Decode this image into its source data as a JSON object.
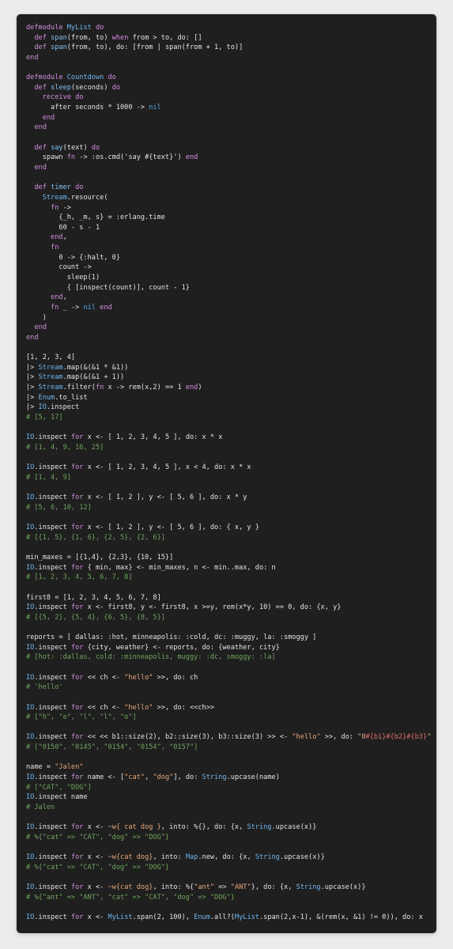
{
  "colors": {
    "background": "#1f1f1f",
    "text": "#e4e4e4",
    "keyword": "#d48ee0",
    "module": "#6fb6f0",
    "function": "#7ec2f5",
    "string": "#e8a87c",
    "comment": "#6fa55d",
    "atom": "#4fa6e8",
    "interpolation": "#e06c75"
  },
  "lines": [
    [
      [
        "keyword",
        "defmodule "
      ],
      [
        "module",
        "MyList"
      ],
      [
        "keyword",
        " do"
      ]
    ],
    [
      [
        "text",
        "  "
      ],
      [
        "keyword",
        "def "
      ],
      [
        "func",
        "span"
      ],
      [
        "text",
        "(from, to) "
      ],
      [
        "keyword",
        "when"
      ],
      [
        "text",
        " from > to, do: []"
      ]
    ],
    [
      [
        "text",
        "  "
      ],
      [
        "keyword",
        "def "
      ],
      [
        "func",
        "span"
      ],
      [
        "text",
        "(from, to), do: [from | span(from + 1, to)]"
      ]
    ],
    [
      [
        "keyword",
        "end"
      ]
    ],
    [],
    [
      [
        "keyword",
        "defmodule "
      ],
      [
        "module",
        "Countdown"
      ],
      [
        "keyword",
        " do"
      ]
    ],
    [
      [
        "text",
        "  "
      ],
      [
        "keyword",
        "def "
      ],
      [
        "func",
        "sleep"
      ],
      [
        "text",
        "(seconds) "
      ],
      [
        "keyword",
        "do"
      ]
    ],
    [
      [
        "text",
        "    "
      ],
      [
        "keyword",
        "receive do"
      ]
    ],
    [
      [
        "text",
        "      after seconds * 1000 -> "
      ],
      [
        "atom",
        "nil"
      ]
    ],
    [
      [
        "text",
        "    "
      ],
      [
        "keyword",
        "end"
      ]
    ],
    [
      [
        "text",
        "  "
      ],
      [
        "keyword",
        "end"
      ]
    ],
    [],
    [
      [
        "text",
        "  "
      ],
      [
        "keyword",
        "def "
      ],
      [
        "func",
        "say"
      ],
      [
        "text",
        "(text) "
      ],
      [
        "keyword",
        "do"
      ]
    ],
    [
      [
        "text",
        "    spawn "
      ],
      [
        "keyword",
        "fn"
      ],
      [
        "text",
        " -> :os.cmd('say #{text}') "
      ],
      [
        "keyword",
        "end"
      ]
    ],
    [
      [
        "text",
        "  "
      ],
      [
        "keyword",
        "end"
      ]
    ],
    [],
    [
      [
        "text",
        "  "
      ],
      [
        "keyword",
        "def "
      ],
      [
        "func",
        "timer "
      ],
      [
        "keyword",
        "do"
      ]
    ],
    [
      [
        "text",
        "    "
      ],
      [
        "module",
        "Stream"
      ],
      [
        "text",
        ".resource("
      ]
    ],
    [
      [
        "text",
        "      "
      ],
      [
        "keyword",
        "fn"
      ],
      [
        "text",
        " ->"
      ]
    ],
    [
      [
        "text",
        "        {_h, _m, s} = :erlang.time"
      ]
    ],
    [
      [
        "text",
        "        60 - s - 1"
      ]
    ],
    [
      [
        "text",
        "      "
      ],
      [
        "keyword",
        "end"
      ],
      [
        "text",
        ","
      ]
    ],
    [
      [
        "text",
        "      "
      ],
      [
        "keyword",
        "fn"
      ]
    ],
    [
      [
        "text",
        "        0 -> {:halt, 0}"
      ]
    ],
    [
      [
        "text",
        "        count ->"
      ]
    ],
    [
      [
        "text",
        "          sleep(1)"
      ]
    ],
    [
      [
        "text",
        "          { [inspect(count)], count - 1}"
      ]
    ],
    [
      [
        "text",
        "      "
      ],
      [
        "keyword",
        "end"
      ],
      [
        "text",
        ","
      ]
    ],
    [
      [
        "text",
        "      "
      ],
      [
        "keyword",
        "fn"
      ],
      [
        "text",
        " _ -> "
      ],
      [
        "atom",
        "nil"
      ],
      [
        "keyword",
        " end"
      ]
    ],
    [
      [
        "text",
        "    )"
      ]
    ],
    [
      [
        "text",
        "  "
      ],
      [
        "keyword",
        "end"
      ]
    ],
    [
      [
        "keyword",
        "end"
      ]
    ],
    [],
    [
      [
        "text",
        "[1, 2, 3, 4]"
      ]
    ],
    [
      [
        "text",
        "|> "
      ],
      [
        "module",
        "Stream"
      ],
      [
        "text",
        ".map(&(&1 * &1))"
      ]
    ],
    [
      [
        "text",
        "|> "
      ],
      [
        "module",
        "Stream"
      ],
      [
        "text",
        ".map(&(&1 + 1))"
      ]
    ],
    [
      [
        "text",
        "|> "
      ],
      [
        "module",
        "Stream"
      ],
      [
        "text",
        ".filter("
      ],
      [
        "keyword",
        "fn"
      ],
      [
        "text",
        " x -> rem(x,2) == 1 "
      ],
      [
        "keyword",
        "end"
      ],
      [
        "text",
        ")"
      ]
    ],
    [
      [
        "text",
        "|> "
      ],
      [
        "module",
        "Enum"
      ],
      [
        "text",
        ".to_list"
      ]
    ],
    [
      [
        "text",
        "|> "
      ],
      [
        "module",
        "IO"
      ],
      [
        "text",
        ".inspect"
      ]
    ],
    [
      [
        "comment",
        "# [5, 17]"
      ]
    ],
    [],
    [
      [
        "module",
        "IO"
      ],
      [
        "text",
        ".inspect "
      ],
      [
        "keyword",
        "for"
      ],
      [
        "text",
        " x <- [ 1, 2, 3, 4, 5 ], do: x * x"
      ]
    ],
    [
      [
        "comment",
        "# [1, 4, 9, 16, 25]"
      ]
    ],
    [],
    [
      [
        "module",
        "IO"
      ],
      [
        "text",
        ".inspect "
      ],
      [
        "keyword",
        "for"
      ],
      [
        "text",
        " x <- [ 1, 2, 3, 4, 5 ], x < 4, do: x * x"
      ]
    ],
    [
      [
        "comment",
        "# [1, 4, 9]"
      ]
    ],
    [],
    [
      [
        "module",
        "IO"
      ],
      [
        "text",
        ".inspect "
      ],
      [
        "keyword",
        "for"
      ],
      [
        "text",
        " x <- [ 1, 2 ], y <- [ 5, 6 ], do: x * y"
      ]
    ],
    [
      [
        "comment",
        "# [5, 6, 10, 12]"
      ]
    ],
    [],
    [
      [
        "module",
        "IO"
      ],
      [
        "text",
        ".inspect "
      ],
      [
        "keyword",
        "for"
      ],
      [
        "text",
        " x <- [ 1, 2 ], y <- [ 5, 6 ], do: { x, y }"
      ]
    ],
    [
      [
        "comment",
        "# [{1, 5}, {1, 6}, {2, 5}, {2, 6}]"
      ]
    ],
    [],
    [
      [
        "text",
        "min_maxes = [{1,4}, {2,3}, {10, 15}]"
      ]
    ],
    [
      [
        "module",
        "IO"
      ],
      [
        "text",
        ".inspect "
      ],
      [
        "keyword",
        "for"
      ],
      [
        "text",
        " { min, max} <- min_maxes, n <- min..max, do: n"
      ]
    ],
    [
      [
        "comment",
        "# [1, 2, 3, 4, 5, 6, 7, 8]"
      ]
    ],
    [],
    [
      [
        "text",
        "first8 = [1, 2, 3, 4, 5, 6, 7, 8]"
      ]
    ],
    [
      [
        "module",
        "IO"
      ],
      [
        "text",
        ".inspect "
      ],
      [
        "keyword",
        "for"
      ],
      [
        "text",
        " x <- first8, y <- first8, x >=y, rem(x*y, 10) == 0, do: {x, y}"
      ]
    ],
    [
      [
        "comment",
        "# [{5, 2}, {5, 4}, {6, 5}, {8, 5}]"
      ]
    ],
    [],
    [
      [
        "text",
        "reports = [ dallas: :hot, minneapolis: :cold, dc: :muggy, la: :smoggy ]"
      ]
    ],
    [
      [
        "module",
        "IO"
      ],
      [
        "text",
        ".inspect "
      ],
      [
        "keyword",
        "for"
      ],
      [
        "text",
        " {city, weather} <- reports, do: {weather, city}"
      ]
    ],
    [
      [
        "comment",
        "# [hot: :dallas, cold: :minneapolis, muggy: :dc, smoggy: :la]"
      ]
    ],
    [],
    [
      [
        "module",
        "IO"
      ],
      [
        "text",
        ".inspect "
      ],
      [
        "keyword",
        "for"
      ],
      [
        "text",
        " << ch <- "
      ],
      [
        "string",
        "\"hello\""
      ],
      [
        "text",
        " >>, do: ch"
      ]
    ],
    [
      [
        "comment",
        "# 'hello'"
      ]
    ],
    [],
    [
      [
        "module",
        "IO"
      ],
      [
        "text",
        ".inspect "
      ],
      [
        "keyword",
        "for"
      ],
      [
        "text",
        " << ch <- "
      ],
      [
        "string",
        "\"hello\""
      ],
      [
        "text",
        " >>, do: <<ch>>"
      ]
    ],
    [
      [
        "comment",
        "# [\"h\", \"e\", \"l\", \"l\", \"o\"]"
      ]
    ],
    [],
    [
      [
        "module",
        "IO"
      ],
      [
        "text",
        ".inspect "
      ],
      [
        "keyword",
        "for"
      ],
      [
        "text",
        " << << b1::size(2), b2::size(3), b3::size(3) >> <- "
      ],
      [
        "string",
        "\"hello\""
      ],
      [
        "text",
        " >>, do: "
      ],
      [
        "string",
        "\"0"
      ],
      [
        "interp",
        "#{b1}#{b2}#{b3}"
      ],
      [
        "string",
        "\""
      ]
    ],
    [
      [
        "comment",
        "# [\"0150\", \"0145\", \"0154\", \"0154\", \"0157\"]"
      ]
    ],
    [],
    [
      [
        "text",
        "name = "
      ],
      [
        "string",
        "\"Jalen\""
      ]
    ],
    [
      [
        "module",
        "IO"
      ],
      [
        "text",
        ".inspect "
      ],
      [
        "keyword",
        "for"
      ],
      [
        "text",
        " name <- ["
      ],
      [
        "string",
        "\"cat\""
      ],
      [
        "text",
        ", "
      ],
      [
        "string",
        "\"dog\""
      ],
      [
        "text",
        "], do: "
      ],
      [
        "module",
        "String"
      ],
      [
        "text",
        ".upcase(name)"
      ]
    ],
    [
      [
        "comment",
        "# [\"CAT\", \"DOG\"]"
      ]
    ],
    [
      [
        "module",
        "IO"
      ],
      [
        "text",
        ".inspect name"
      ]
    ],
    [
      [
        "comment",
        "# Jalen"
      ]
    ],
    [],
    [
      [
        "module",
        "IO"
      ],
      [
        "text",
        ".inspect "
      ],
      [
        "keyword",
        "for"
      ],
      [
        "text",
        " x <- "
      ],
      [
        "string",
        "~w{ cat dog }"
      ],
      [
        "text",
        ", into: %{}, do: {x, "
      ],
      [
        "module",
        "String"
      ],
      [
        "text",
        ".upcase(x)}"
      ]
    ],
    [
      [
        "comment",
        "# %{\"cat\" => \"CAT\", \"dog\" => \"DOG\"}"
      ]
    ],
    [],
    [
      [
        "module",
        "IO"
      ],
      [
        "text",
        ".inspect "
      ],
      [
        "keyword",
        "for"
      ],
      [
        "text",
        " x <- "
      ],
      [
        "string",
        "~w{cat dog}"
      ],
      [
        "text",
        ", into: "
      ],
      [
        "module",
        "Map"
      ],
      [
        "text",
        ".new, do: {x, "
      ],
      [
        "module",
        "String"
      ],
      [
        "text",
        ".upcase(x)}"
      ]
    ],
    [
      [
        "comment",
        "# %{\"cat\" => \"CAT\", \"dog\" => \"DOG\"}"
      ]
    ],
    [],
    [
      [
        "module",
        "IO"
      ],
      [
        "text",
        ".inspect "
      ],
      [
        "keyword",
        "for"
      ],
      [
        "text",
        " x <- "
      ],
      [
        "string",
        "~w{cat dog}"
      ],
      [
        "text",
        ", into: %{"
      ],
      [
        "string",
        "\"ant\""
      ],
      [
        "text",
        " => "
      ],
      [
        "string",
        "\"ANT\""
      ],
      [
        "text",
        "}, do: {x, "
      ],
      [
        "module",
        "String"
      ],
      [
        "text",
        ".upcase(x)}"
      ]
    ],
    [
      [
        "comment",
        "# %{\"ant\" => \"ANT\", \"cat\" => \"CAT\", \"dog\" => \"DOG\"}"
      ]
    ],
    [],
    [
      [
        "module",
        "IO"
      ],
      [
        "text",
        ".inspect "
      ],
      [
        "keyword",
        "for"
      ],
      [
        "text",
        " x <- "
      ],
      [
        "module",
        "MyList"
      ],
      [
        "text",
        ".span(2, 100), "
      ],
      [
        "module",
        "Enum"
      ],
      [
        "text",
        ".all?("
      ],
      [
        "module",
        "MyList"
      ],
      [
        "text",
        ".span(2,x-1), &(rem(x, &1) != 0)), do: x"
      ]
    ]
  ]
}
